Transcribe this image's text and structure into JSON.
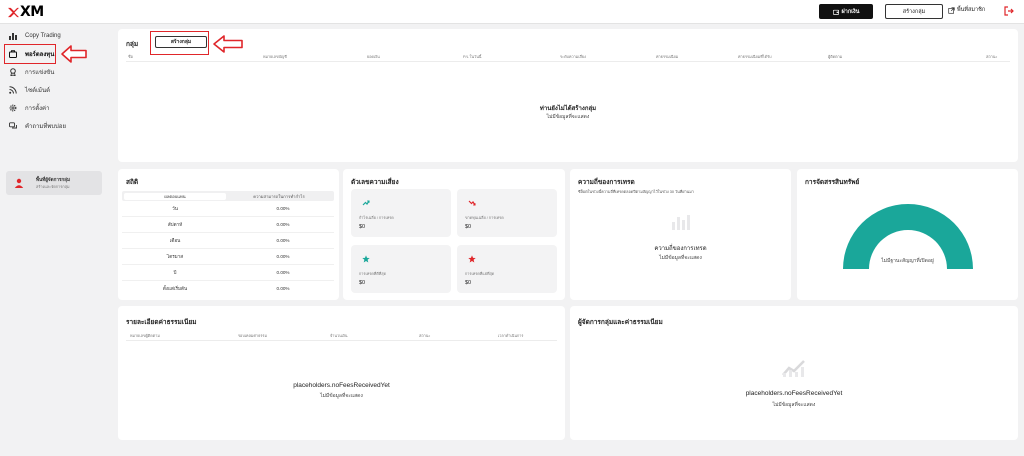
{
  "header": {
    "logo_text": "XM",
    "deposit_label": "ฝากเงิน",
    "create_group_label": "สร้างกลุ่ม",
    "external_link_label": "พื้นที่สมาชิก"
  },
  "sidebar": {
    "items": [
      {
        "label": "Copy Trading",
        "icon": "chart-bars-icon"
      },
      {
        "label": "พอร์ตลงทุน",
        "icon": "briefcase-icon"
      },
      {
        "label": "การแข่งขัน",
        "icon": "trophy-icon"
      },
      {
        "label": "ไซต์เม้นต์",
        "icon": "rss-icon"
      },
      {
        "label": "การตั้งค่า",
        "icon": "gear-icon"
      },
      {
        "label": "คำถามที่พบบ่อย",
        "icon": "chat-icon"
      }
    ],
    "partner": {
      "title": "พื้นที่ผู้จัดการกลุ่ม",
      "subtitle": "สร้างและจัดการกลุ่ม"
    }
  },
  "groups_panel": {
    "title": "กลุ่ม",
    "create_button": "สร้างกลุ่ม",
    "columns": [
      "ชื่อ",
      "หมายเลขบัญชี",
      "ยอดเงิน",
      "P/L ในวันนี้",
      "ระดับความเสี่ยง",
      "ค่าธรรมเนียม",
      "ค่าธรรมเนียมที่ได้รับ",
      "ผู้ติดตาม",
      "สถานะ"
    ],
    "empty_title": "ท่านยังไม่ได้สร้างกลุ่ม",
    "empty_subtitle": "ไม่มีข้อมูลที่จะแสดง"
  },
  "stats_panel": {
    "title": "สถิติ",
    "tabs": [
      "ผลตอบแทน",
      "ความสามารถในการทำกำไร"
    ],
    "rows": [
      {
        "label": "วัน",
        "value": "0.00%"
      },
      {
        "label": "สัปดาห์",
        "value": "0.00%"
      },
      {
        "label": "เดือน",
        "value": "0.00%"
      },
      {
        "label": "ไตรมาส",
        "value": "0.00%"
      },
      {
        "label": "ปี",
        "value": "0.00%"
      },
      {
        "label": "ตั้งแต่เริ่มต้น",
        "value": "0.00%"
      }
    ]
  },
  "risk_panel": {
    "title": "ตัวเลขความเสี่ยง",
    "cards": [
      {
        "label": "กำไรเฉลี่ย / การเทรด",
        "value": "$0",
        "icon": "trend-up-icon",
        "color": "#1aa79a"
      },
      {
        "label": "ขาดทุนเฉลี่ย / การเทรด",
        "value": "$0",
        "icon": "trend-down-icon",
        "color": "#e0262a"
      },
      {
        "label": "การเทรดที่ดีที่สุด",
        "value": "$0",
        "icon": "star-icon",
        "color": "#1aa79a"
      },
      {
        "label": "การเทรดที่แย่ที่สุด",
        "value": "$0",
        "icon": "star-icon",
        "color": "#e0262a"
      }
    ]
  },
  "frequency_panel": {
    "title": "ความถี่ของการเทรด",
    "subtitle": "ซีล็อตในช่วงนี้ความถี่ที่เทรดตลอดปีตามสัญญาไว้ในช่วง 30 วันที่ผ่านมา",
    "empty_title": "ความถี่ของการเทรด",
    "empty_subtitle": "ไม่มีข้อมูลที่จะแสดง"
  },
  "allocation_panel": {
    "title": "การจัดสรรสินทรัพย์",
    "empty_label": "ไม่มีฐานะสัญญาที่เปิดอยู่",
    "gauge_color": "#1aa79a"
  },
  "fees_panel": {
    "title": "รายละเอียดค่าธรรมเนียม",
    "columns": [
      "หมายเลขผู้ติดตาม",
      "รอบเคลมค่าธรรม",
      "จำนวนเงิน",
      "สถานะ",
      "เวลาดำเนินการ"
    ],
    "empty_title": "placeholders.noFeesReceivedYet",
    "empty_subtitle": "ไม่มีข้อมูลที่จะแสดง"
  },
  "managers_panel": {
    "title": "ผู้จัดการกลุ่มและค่าธรรมเนียม",
    "empty_title": "placeholders.noFeesReceivedYet",
    "empty_subtitle": "ไม่มีข้อมูลที่จะแสดง"
  }
}
